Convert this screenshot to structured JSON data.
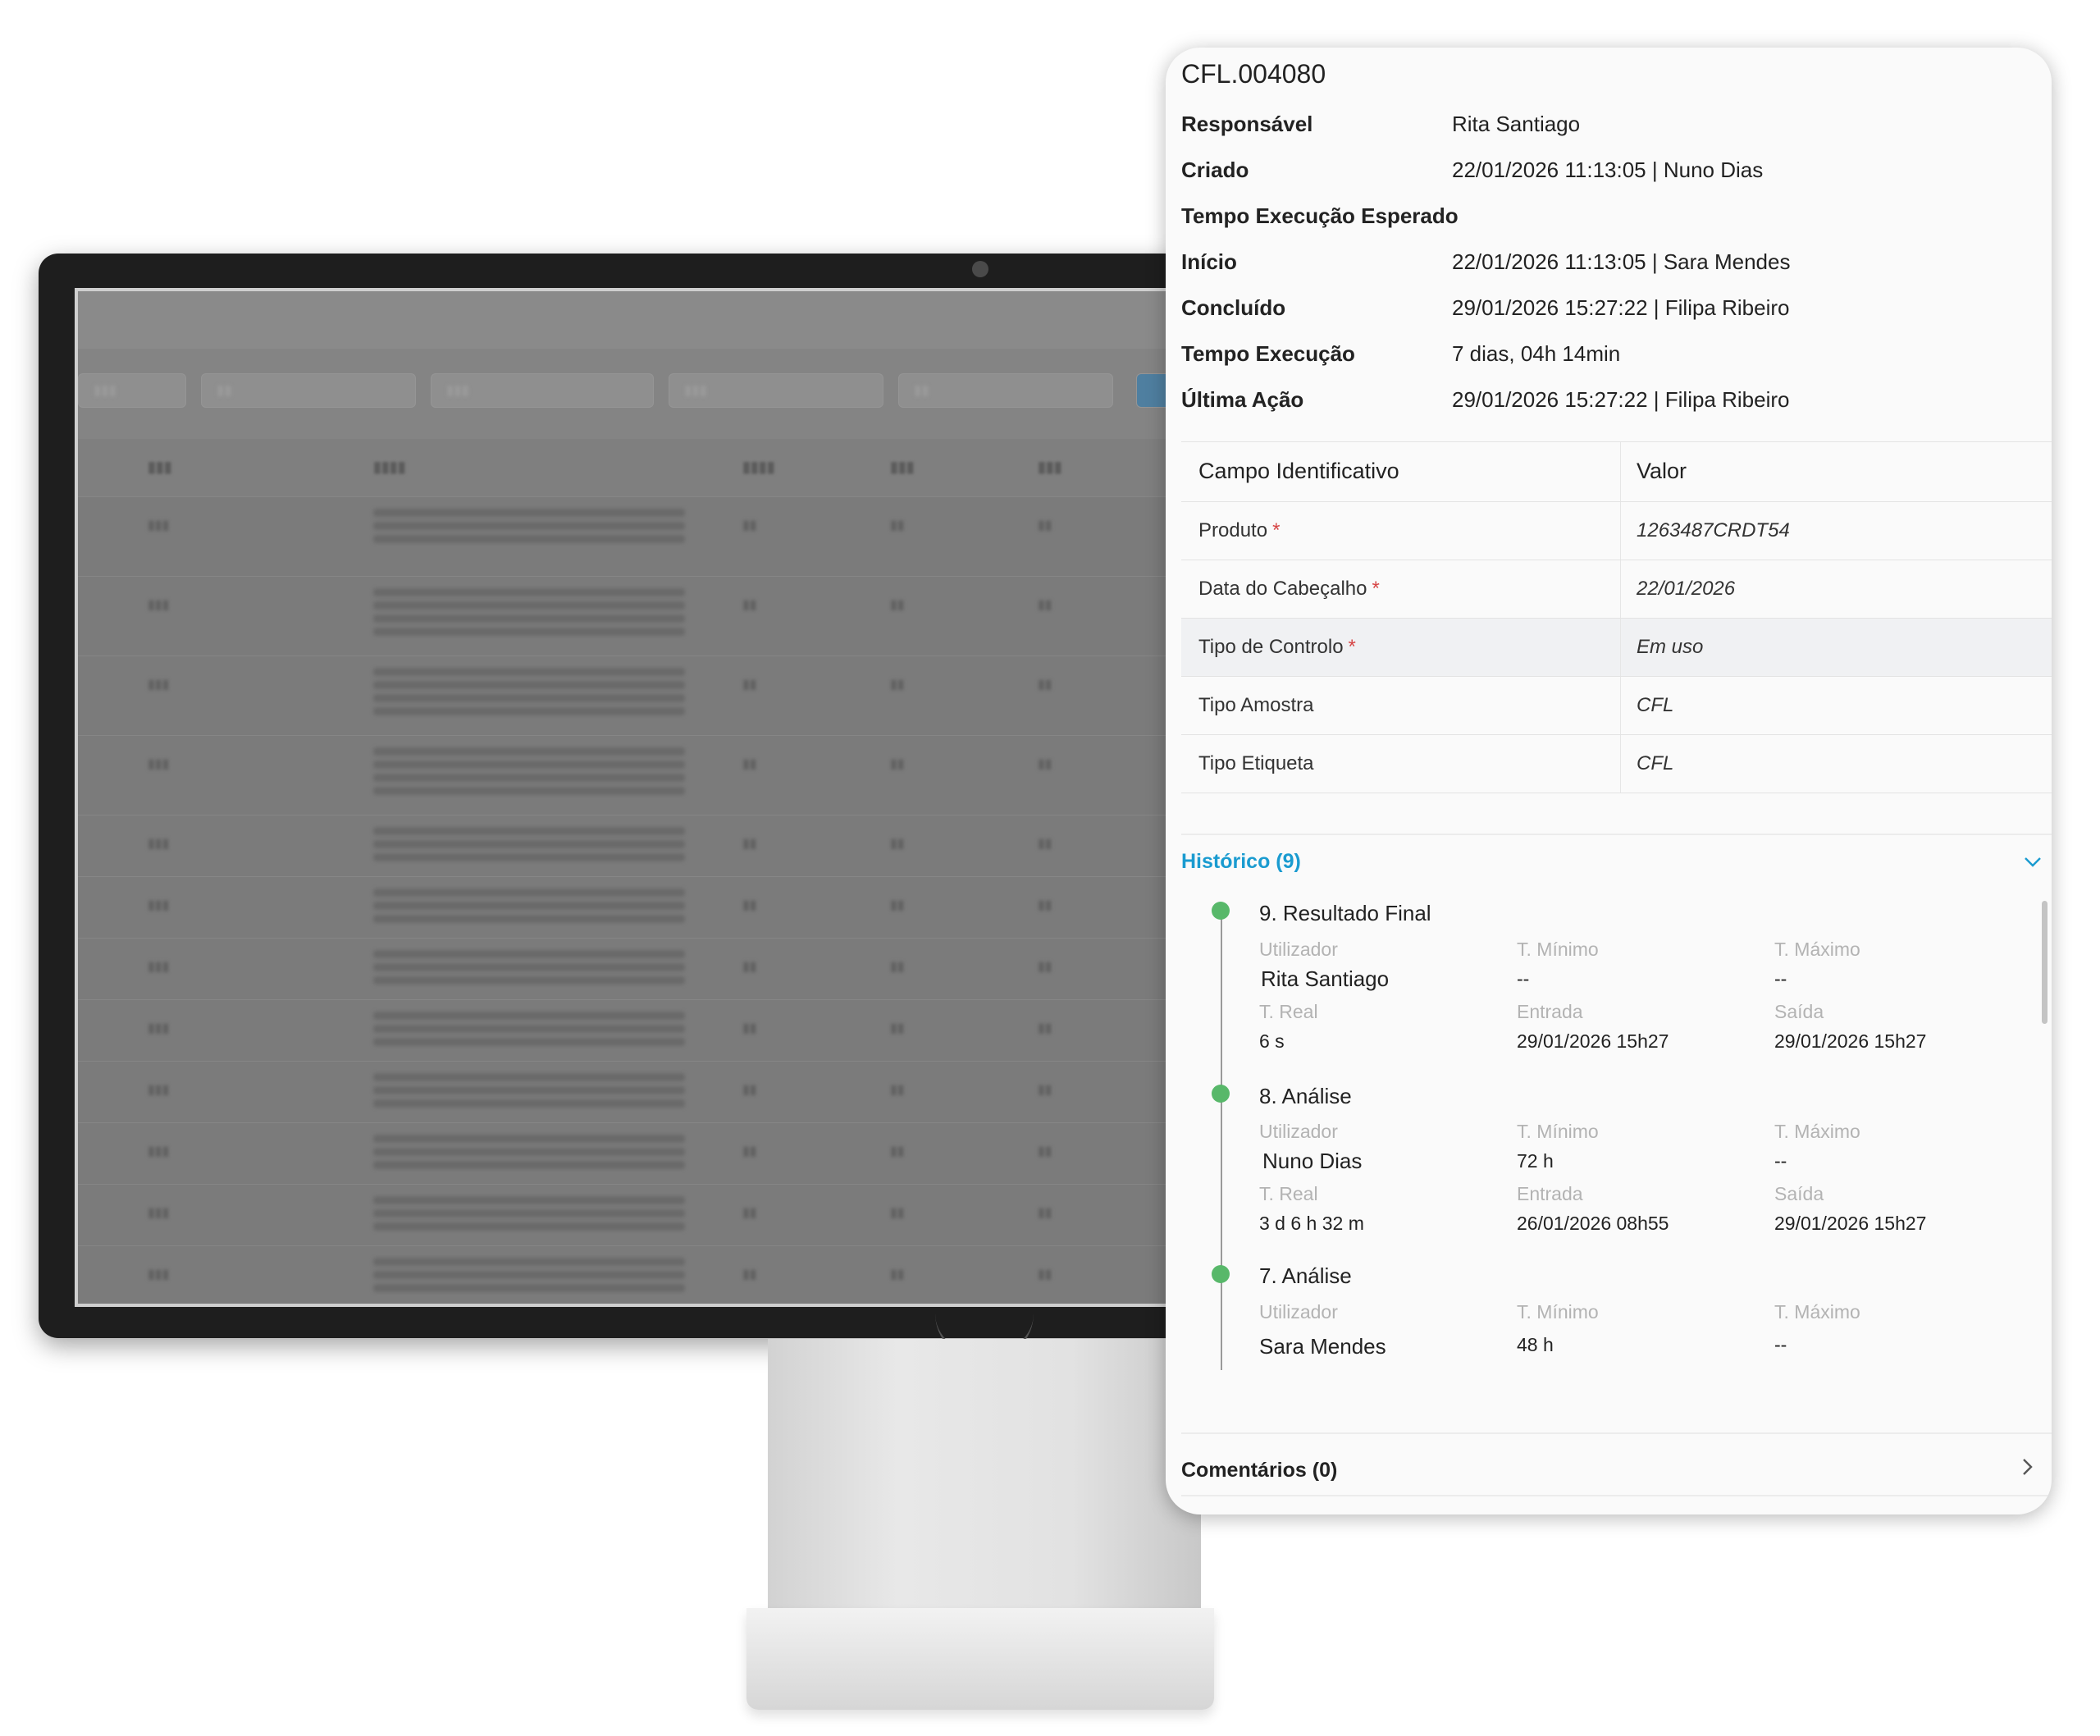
{
  "panel": {
    "title": "CFL.004080",
    "info": [
      {
        "label": "Responsável",
        "value": "Rita Santiago"
      },
      {
        "label": "Criado",
        "value": "22/01/2026 11:13:05 | Nuno Dias"
      },
      {
        "label": "Tempo Execução Esperado",
        "value": ""
      },
      {
        "label": "Início",
        "value": "22/01/2026 11:13:05 | Sara Mendes"
      },
      {
        "label": "Concluído",
        "value": "29/01/2026 15:27:22 | Filipa Ribeiro"
      },
      {
        "label": "Tempo Execução",
        "value": "7 dias, 04h 14min"
      },
      {
        "label": "Última Ação",
        "value": "29/01/2026 15:27:22 | Filipa Ribeiro"
      }
    ],
    "fields_table": {
      "headers": [
        "Campo Identificativo",
        "Valor"
      ],
      "rows": [
        {
          "field": "Produto",
          "required": "*",
          "value": "1263487CRDT54"
        },
        {
          "field": "Data do Cabeçalho",
          "required": "*",
          "value": "22/01/2026"
        },
        {
          "field": "Tipo de Controlo",
          "required": "*",
          "value": "Em uso"
        },
        {
          "field": "Tipo Amostra",
          "required": "",
          "value": "CFL"
        },
        {
          "field": "Tipo Etiqueta",
          "required": "",
          "value": "CFL"
        }
      ]
    },
    "history": {
      "title": "Histórico (9)",
      "labels": {
        "user": "Utilizador",
        "t_min": "T. Mínimo",
        "t_max": "T. Máximo",
        "t_real": "T. Real",
        "entry": "Entrada",
        "exit": "Saída"
      },
      "steps": [
        {
          "title": "9. Resultado Final",
          "user": "Rita Santiago",
          "t_min": "--",
          "t_max": "--",
          "t_real": "6 s",
          "entry": "29/01/2026 15h27",
          "exit": "29/01/2026 15h27"
        },
        {
          "title": "8. Análise",
          "user": "Nuno Dias",
          "t_min": "72 h",
          "t_max": "--",
          "t_real": "3 d 6 h 32 m",
          "entry": "26/01/2026 08h55",
          "exit": "29/01/2026 15h27"
        },
        {
          "title": "7. Análise",
          "user": "Sara Mendes",
          "t_min": "48 h",
          "t_max": "--"
        }
      ]
    },
    "comments": "Comentários (0)",
    "colors": {
      "accent": "#1a9bd0",
      "dot": "#58b86a",
      "required": "#d64545"
    }
  }
}
